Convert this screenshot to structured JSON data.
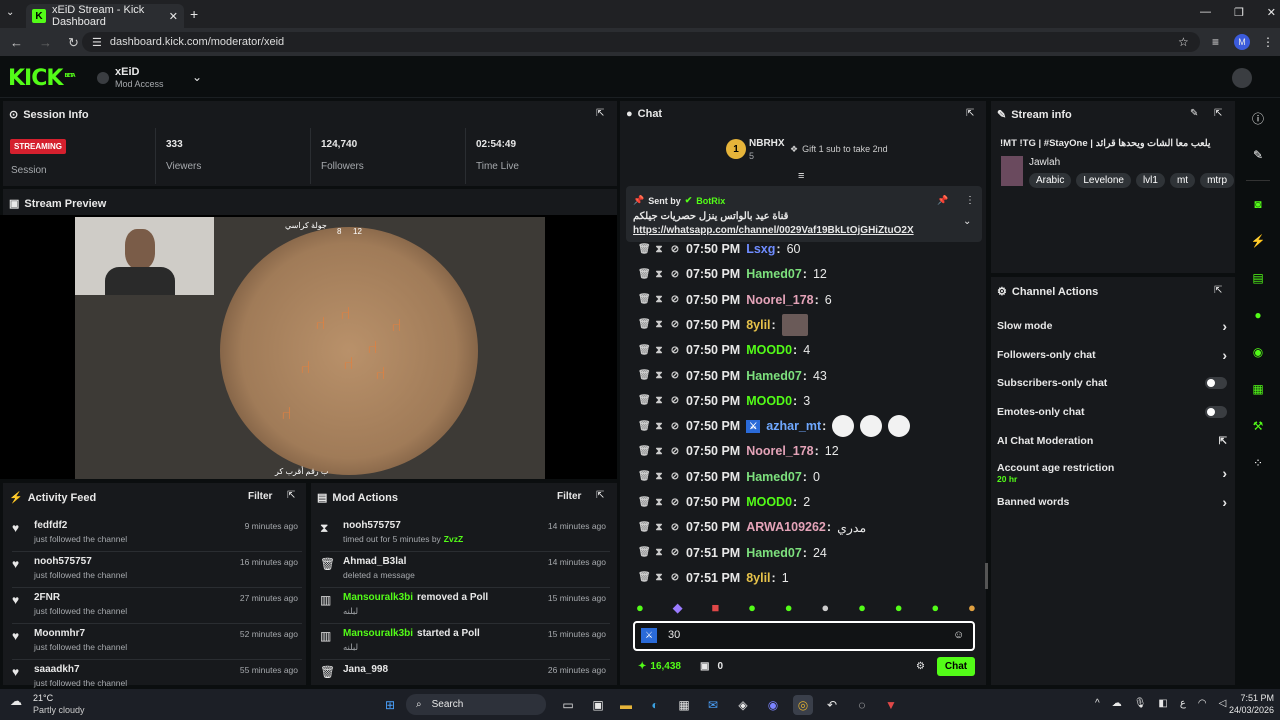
{
  "browser": {
    "tab_title": "xEiD Stream - Kick Dashboard",
    "url": "dashboard.kick.com/moderator/xeid",
    "profile_initial": "M",
    "new_tab": "+"
  },
  "header": {
    "logo": "KICK",
    "beta": "BETA",
    "channel": "xEiD",
    "role": "Mod Access"
  },
  "session": {
    "title": "Session Info",
    "status": "STREAMING",
    "status_label": "Session",
    "viewers": "333",
    "viewers_label": "Viewers",
    "followers": "124,740",
    "followers_label": "Followers",
    "time": "02:54:49",
    "time_label": "Time Live"
  },
  "preview": {
    "title": "Stream Preview",
    "game_title": "جولة كراسي",
    "game_numbers": [
      "8",
      "12"
    ],
    "game_bottom": "ب رقم أقرب كر"
  },
  "activity": {
    "title": "Activity Feed",
    "filter": "Filter",
    "items": [
      {
        "name": "fedfdf2",
        "desc": "just followed the channel",
        "time": "9 minutes ago"
      },
      {
        "name": "nooh575757",
        "desc": "just followed the channel",
        "time": "16 minutes ago"
      },
      {
        "name": "2FNR",
        "desc": "just followed the channel",
        "time": "27 minutes ago"
      },
      {
        "name": "Moonmhr7",
        "desc": "just followed the channel",
        "time": "52 minutes ago"
      },
      {
        "name": "saaadkh7",
        "desc": "just followed the channel",
        "time": "55 minutes ago"
      }
    ]
  },
  "modactions": {
    "title": "Mod Actions",
    "filter": "Filter",
    "items": [
      {
        "name": "nooh575757",
        "desc": "timed out for 5 minutes by",
        "by": "ZvzZ",
        "time": "14 minutes ago",
        "icon": "hourglass"
      },
      {
        "name": "Ahmad_B3lal",
        "desc": "deleted a message",
        "by": "",
        "time": "14 minutes ago",
        "icon": "trash"
      },
      {
        "name": "Mansouralk3bi",
        "action": "removed a Poll",
        "desc": "لبلنه",
        "time": "15 minutes ago",
        "icon": "chart"
      },
      {
        "name": "Mansouralk3bi",
        "action": "started a Poll",
        "desc": "لبلنه",
        "time": "15 minutes ago",
        "icon": "chart"
      },
      {
        "name": "Jana_998",
        "desc": "",
        "time": "26 minutes ago",
        "icon": "trash"
      }
    ]
  },
  "chat": {
    "title": "Chat",
    "top_gifter": "NBRHX",
    "top_count": "5",
    "rank": "1",
    "gift_text": "Gift 1 sub to take 2nd",
    "pinned": {
      "sent_by": "Sent by",
      "user": "BotRix",
      "text": "قناة عيد بالواتس ينزل حصريات جيلكم",
      "link": "https://whatsapp.com/channel/0029Vaf19BkLtOjGHiZtuO2X"
    },
    "messages": [
      {
        "time": "07:50 PM",
        "user": "Lsxg",
        "msg": "60",
        "color": "#6f8cff"
      },
      {
        "time": "07:50 PM",
        "user": "Hamed07",
        "msg": "12",
        "color": "#7de07d"
      },
      {
        "time": "07:50 PM",
        "user": "Noorel_178",
        "msg": "6",
        "color": "#e4a3b8"
      },
      {
        "time": "07:50 PM",
        "user": "8ylil",
        "msg": "",
        "color": "#e6c24a"
      },
      {
        "time": "07:50 PM",
        "user": "MOOD0",
        "msg": "4",
        "color": "#53fc18"
      },
      {
        "time": "07:50 PM",
        "user": "Hamed07",
        "msg": "43",
        "color": "#7de07d"
      },
      {
        "time": "07:50 PM",
        "user": "MOOD0",
        "msg": "3",
        "color": "#53fc18"
      },
      {
        "time": "07:50 PM",
        "user": "azhar_mt",
        "msg": "",
        "color": "#6fa8ff"
      },
      {
        "time": "07:50 PM",
        "user": "Noorel_178",
        "msg": "12",
        "color": "#e4a3b8"
      },
      {
        "time": "07:50 PM",
        "user": "Hamed07",
        "msg": "0",
        "color": "#7de07d"
      },
      {
        "time": "07:50 PM",
        "user": "MOOD0",
        "msg": "2",
        "color": "#53fc18"
      },
      {
        "time": "07:50 PM",
        "user": "ARWA109262",
        "msg": "مدري",
        "color": "#e4a3b8"
      },
      {
        "time": "07:51 PM",
        "user": "Hamed07",
        "msg": "24",
        "color": "#7de07d"
      },
      {
        "time": "07:51 PM",
        "user": "8ylil",
        "msg": "1",
        "color": "#e6c24a"
      }
    ],
    "input_value": "30",
    "points": "16,438",
    "sub_count": "0",
    "send": "Chat"
  },
  "streaminfo": {
    "title": "Stream info",
    "stream_title": "!MT !TG | #StayOne | يلعب معا الشات ويحدها قرائد",
    "category": "Jawlah",
    "tags": [
      "Arabic",
      "Levelone",
      "lvl1",
      "mt",
      "mtrp"
    ]
  },
  "channel_actions": {
    "title": "Channel Actions",
    "items": [
      {
        "label": "Slow mode",
        "kind": "arrow"
      },
      {
        "label": "Followers-only chat",
        "kind": "arrow"
      },
      {
        "label": "Subscribers-only chat",
        "kind": "toggle"
      },
      {
        "label": "Emotes-only chat",
        "kind": "toggle"
      },
      {
        "label": "AI Chat Moderation",
        "kind": "link"
      },
      {
        "label": "Account age restriction",
        "sub": "20 hr",
        "kind": "arrow"
      },
      {
        "label": "Banned words",
        "kind": "arrow"
      }
    ]
  },
  "taskbar": {
    "temp": "21°C",
    "weather": "Partly cloudy",
    "search": "Search",
    "time": "7:51 PM",
    "date": "24/03/2026",
    "lang": "ع"
  },
  "colors": {
    "accent": "#53fc18",
    "panel": "#17191c",
    "bg": "#0b0e0f",
    "streaming": "#d5202e"
  }
}
